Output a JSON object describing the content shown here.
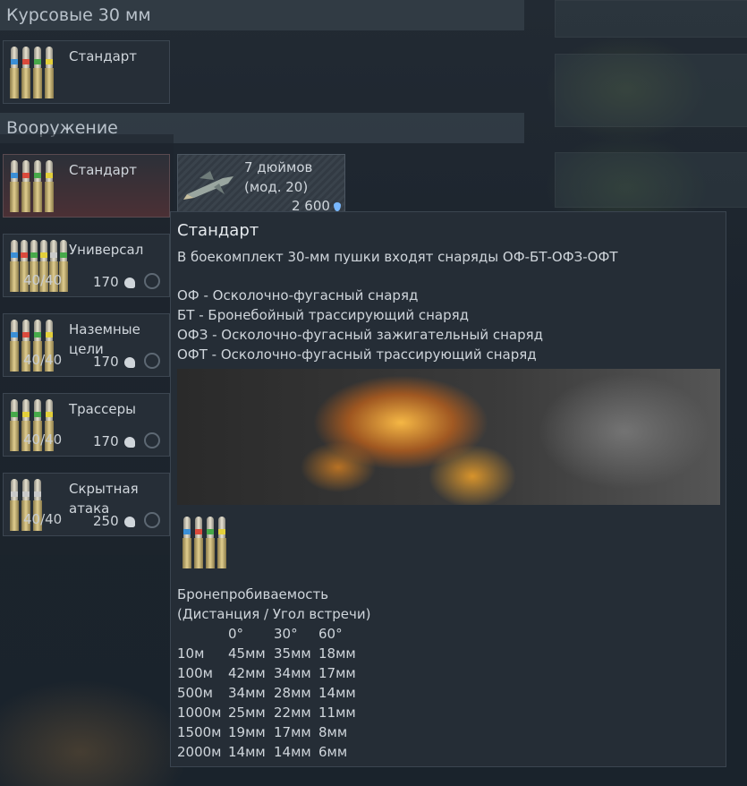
{
  "sections": {
    "courses_title": "Курсовые 30 мм",
    "armament_title": "Вооружение"
  },
  "course_item": {
    "name": "Стандарт",
    "bands": [
      "#3b8fd6",
      "#d94a3c",
      "#47a94a",
      "#e3cf3b"
    ]
  },
  "armament_items": [
    {
      "name": "Стандарт",
      "count": "",
      "price": "",
      "selected": true,
      "bands": [
        "#3b8fd6",
        "#d94a3c",
        "#47a94a",
        "#e3cf3b"
      ]
    },
    {
      "name": "Универсал",
      "count": "40/40",
      "price": "170",
      "selected": false,
      "bands": [
        "#3b8fd6",
        "#d94a3c",
        "#47a94a",
        "#e3cf3b",
        "#c9c9c9",
        "#47a94a"
      ]
    },
    {
      "name": "Наземные\nцели",
      "count": "40/40",
      "price": "170",
      "selected": false,
      "bands": [
        "#3b8fd6",
        "#d94a3c",
        "#47a94a",
        "#e3cf3b"
      ]
    },
    {
      "name": "Трассеры",
      "count": "40/40",
      "price": "170",
      "selected": false,
      "bands": [
        "#47a94a",
        "#e3cf3b",
        "#47a94a",
        "#e3cf3b"
      ]
    },
    {
      "name": "Скрытная\nатака",
      "count": "40/40",
      "price": "250",
      "selected": false,
      "bands": [
        "#c9c9c9",
        "#c9c9c9",
        "#c9c9c9"
      ]
    }
  ],
  "rocket": {
    "name_line1": "7 дюймов",
    "name_line2": "(мод. 20)",
    "price": "2 600"
  },
  "tooltip": {
    "title": "Стандарт",
    "description": "В боекомплект 30-мм пушки входят снаряды ОФ-БТ-ОФЗ-ОФТ",
    "legend": [
      "ОФ - Осколочно-фугасный снаряд",
      "БТ - Бронебойный трассирующий снаряд",
      "ОФЗ - Осколочно-фугасный зажигательный снаряд",
      "ОФТ - Осколочно-фугасный трассирующий снаряд"
    ],
    "penetration_title": "Бронепробиваемость",
    "penetration_subtitle": "(Дистанция / Угол встречи)",
    "angles": [
      "0°",
      "30°",
      "60°"
    ],
    "rows": [
      {
        "distance": "10м",
        "values": [
          "45мм",
          "35мм",
          "18мм"
        ]
      },
      {
        "distance": "100м",
        "values": [
          "42мм",
          "34мм",
          "17мм"
        ]
      },
      {
        "distance": "500м",
        "values": [
          "34мм",
          "28мм",
          "14мм"
        ]
      },
      {
        "distance": "1000м",
        "values": [
          "25мм",
          "22мм",
          "11мм"
        ]
      },
      {
        "distance": "1500м",
        "values": [
          "19мм",
          "17мм",
          "8мм"
        ]
      },
      {
        "distance": "2000м",
        "values": [
          "14мм",
          "14мм",
          "6мм"
        ]
      }
    ]
  },
  "colors": {
    "accent_gem": "#79b8ff",
    "selected_gradient": "#4b3035"
  }
}
